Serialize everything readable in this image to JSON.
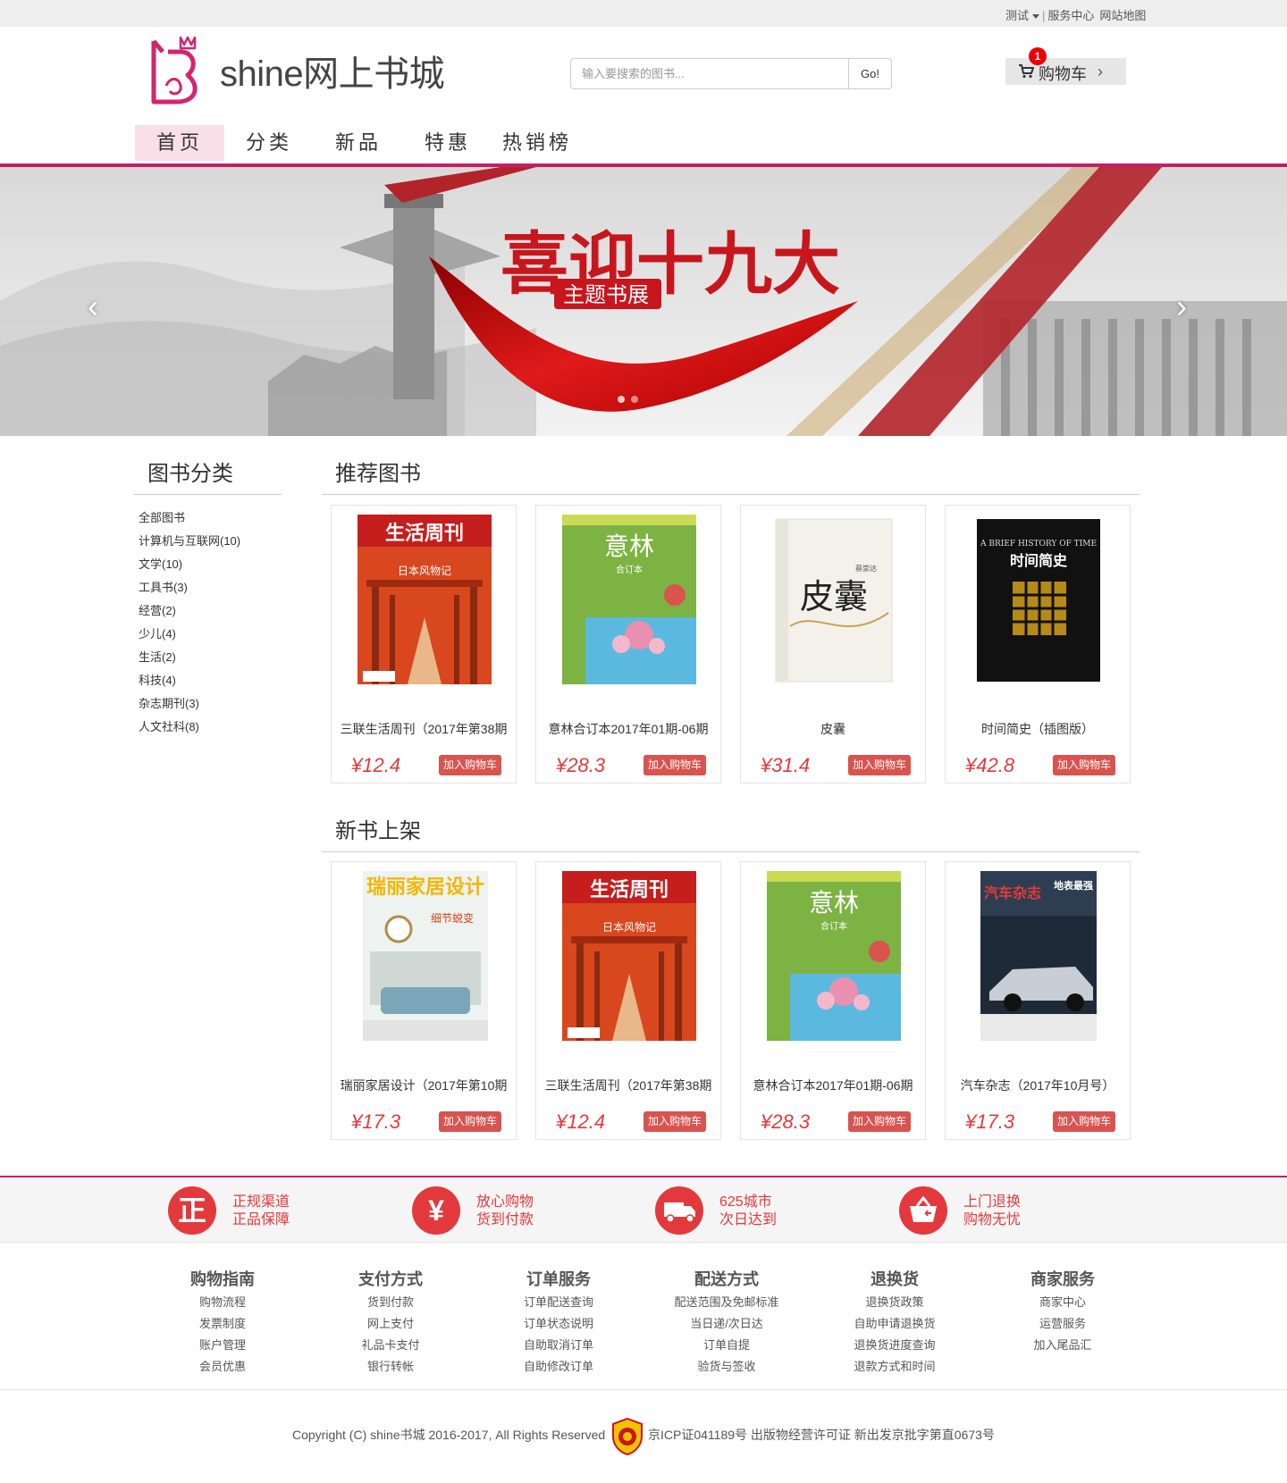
{
  "topbar": {
    "user": "测试",
    "links": [
      "服务中心",
      "网站地图"
    ]
  },
  "header": {
    "site_title": "shine网上书城",
    "search_placeholder": "输入要搜索的图书...",
    "search_button": "Go!",
    "cart_label": "购物车",
    "cart_count": "1"
  },
  "nav": [
    "首页",
    "分类",
    "新品",
    "特惠",
    "热销榜"
  ],
  "banner": {
    "headline": "喜迎十九大",
    "subline": "主题书展"
  },
  "sidebar": {
    "title": "图书分类",
    "categories": [
      "全部图书",
      "计算机与互联网(10)",
      "文学(10)",
      "工具书(3)",
      "经营(2)",
      "少儿(4)",
      "生活(2)",
      "科技(4)",
      "杂志期刊(3)",
      "人文社科(8)"
    ]
  },
  "recommended": {
    "title": "推荐图书",
    "add_label": "加入购物车",
    "books": [
      {
        "title": "三联生活周刊（2017年第38期",
        "price": "¥12.4",
        "cover_text": "生活周刊",
        "cover_sub": "日本风物记"
      },
      {
        "title": "意林合订本2017年01期-06期",
        "price": "¥28.3",
        "cover_text": "意林",
        "cover_sub": "合订本"
      },
      {
        "title": "皮囊",
        "price": "¥31.4",
        "cover_text": "皮囊",
        "cover_sub": "蔡崇达"
      },
      {
        "title": "时间简史（插图版）",
        "price": "¥42.8",
        "cover_text": "时间简史",
        "cover_sub": "A BRIEF HISTORY OF TIME"
      }
    ]
  },
  "new_books": {
    "title": "新书上架",
    "add_label": "加入购物车",
    "books": [
      {
        "title": "瑞丽家居设计（2017年第10期",
        "price": "¥17.3",
        "cover_text": "瑞丽家居设计",
        "cover_sub": "细节蜕变"
      },
      {
        "title": "三联生活周刊（2017年第38期",
        "price": "¥12.4",
        "cover_text": "生活周刊",
        "cover_sub": "日本风物记"
      },
      {
        "title": "意林合订本2017年01期-06期",
        "price": "¥28.3",
        "cover_text": "意林",
        "cover_sub": "合订本"
      },
      {
        "title": "汽车杂志（2017年10月号）",
        "price": "¥17.3",
        "cover_text": "汽车杂志",
        "cover_sub": "地表最强"
      }
    ]
  },
  "services": [
    {
      "icon": "zheng-icon",
      "glyph": "正",
      "line1": "正规渠道",
      "line2": "正品保障"
    },
    {
      "icon": "yen-icon",
      "glyph": "¥",
      "line1": "放心购物",
      "line2": "货到付款"
    },
    {
      "icon": "truck-icon",
      "glyph": "",
      "line1": "625城市",
      "line2": "次日达到"
    },
    {
      "icon": "return-icon",
      "glyph": "",
      "line1": "上门退换",
      "line2": "购物无忧"
    }
  ],
  "footer_columns": [
    {
      "heading": "购物指南",
      "links": [
        "购物流程",
        "发票制度",
        "账户管理",
        "会员优惠"
      ]
    },
    {
      "heading": "支付方式",
      "links": [
        "货到付款",
        "网上支付",
        "礼品卡支付",
        "银行转帐"
      ]
    },
    {
      "heading": "订单服务",
      "links": [
        "订单配送查询",
        "订单状态说明",
        "自助取消订单",
        "自助修改订单"
      ]
    },
    {
      "heading": "配送方式",
      "links": [
        "配送范围及免邮标准",
        "当日递/次日达",
        "订单自提",
        "验货与签收"
      ]
    },
    {
      "heading": "退换货",
      "links": [
        "退换货政策",
        "自助申请退换货",
        "退换货进度查询",
        "退款方式和时间"
      ]
    },
    {
      "heading": "商家服务",
      "links": [
        "商家中心",
        "运营服务",
        "加入尾品汇"
      ]
    }
  ],
  "copyright": "Copyright (C) shine书城 2016-2017, All Rights Reserved",
  "icp": "京ICP证041189号 出版物经营许可证 新出发京批字第直0673号",
  "colors": {
    "brand": "#c41e6a",
    "price": "#e4393c",
    "button": "#d9534f"
  }
}
